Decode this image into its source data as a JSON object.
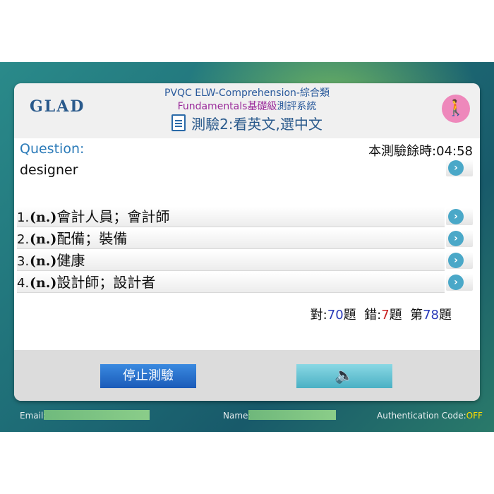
{
  "header": {
    "logo": "GLAD",
    "line1": "PVQC ELW-Comprehension-綜合類",
    "line2_main": "Fundamentals基礎級",
    "line2_tail": "測評系統",
    "title": "測驗2:看英文,選中文",
    "doc_icon": "document-icon",
    "exit_icon": "walking-person-icon"
  },
  "question": {
    "label": "Question:",
    "timer": "本測驗餘時:04:58",
    "word": "designer"
  },
  "options": [
    {
      "num": "1.",
      "pos": "(n.)",
      "text": "會計人員；會計師"
    },
    {
      "num": "2.",
      "pos": "(n.)",
      "text": "配備；裝備"
    },
    {
      "num": "3.",
      "pos": "(n.)",
      "text": "健康"
    },
    {
      "num": "4.",
      "pos": "(n.)",
      "text": "設計師；設計者"
    }
  ],
  "score": {
    "correct_label": "對:",
    "correct": "70",
    "correct_suffix": "題",
    "wrong_label": "錯:",
    "wrong": "7",
    "wrong_suffix": "題",
    "current_label": "第",
    "current": "78",
    "current_suffix": "題"
  },
  "buttons": {
    "stop": "停止測驗",
    "sound_icon": "speaker-icon"
  },
  "footer": {
    "email_label": "Email:",
    "name_label": "Name:",
    "auth_label": "Authentication Code:",
    "auth_value": "OFF"
  },
  "colors": {
    "accent_blue": "#2a5a9c",
    "accent_purple": "#9a2a9a",
    "correct_blue": "#2a3ab8",
    "wrong_red": "#c82020"
  }
}
